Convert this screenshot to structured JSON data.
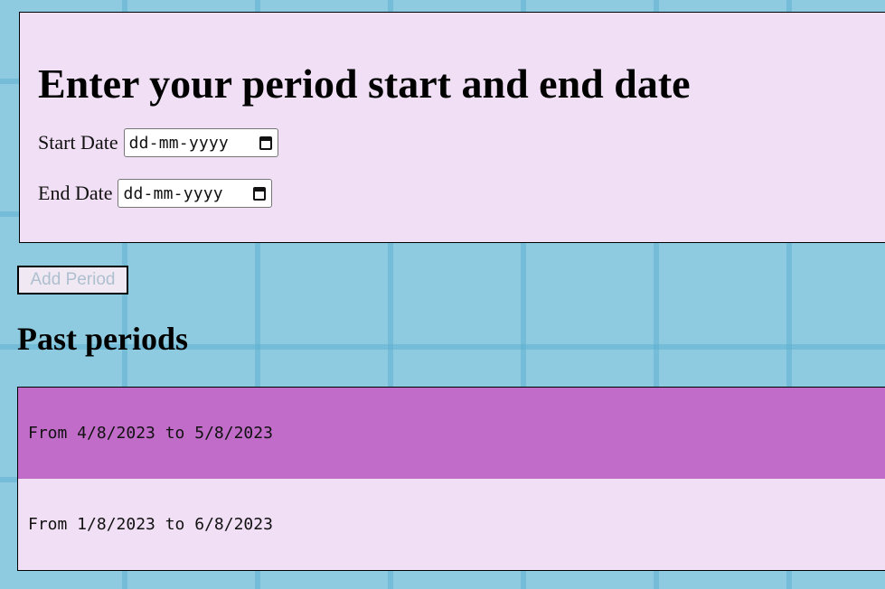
{
  "form": {
    "title": "Enter your period start and end date",
    "start_label": "Start Date",
    "start_value": "dd-mm-yyyy",
    "end_label": "End Date",
    "end_value": "dd-mm-yyyy",
    "calendar_icon": "calendar-icon"
  },
  "add_button": {
    "label": "Add Period",
    "state": "disabled"
  },
  "past": {
    "title": "Past periods",
    "items": [
      "From 4/8/2023 to 5/8/2023",
      "From 1/8/2023 to 6/8/2023"
    ]
  },
  "colors": {
    "background": "#8fcbe0",
    "panel": "#f1dff5",
    "highlight_row": "#c06cc8"
  }
}
